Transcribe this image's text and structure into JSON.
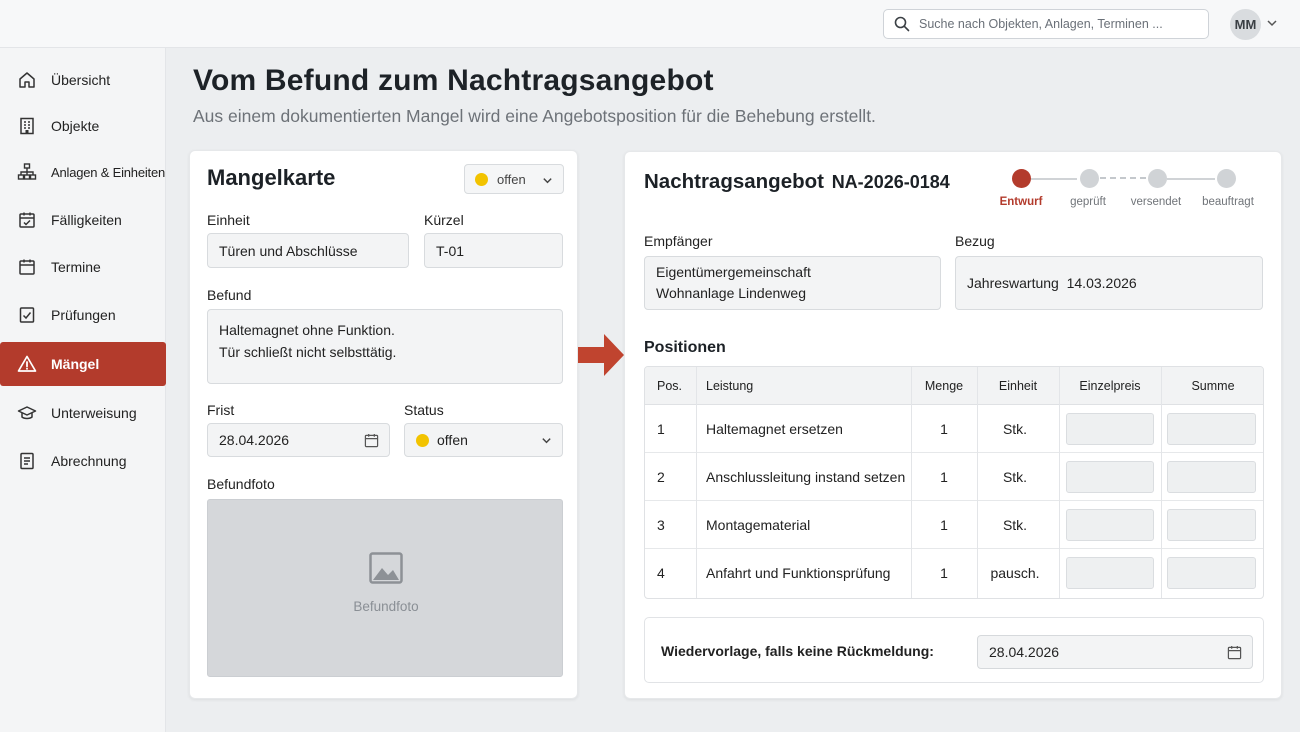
{
  "search": {
    "placeholder": "Suche nach Objekten, Anlagen, Terminen ..."
  },
  "user": {
    "initials": "MM"
  },
  "sidebar": {
    "items": [
      {
        "label": "Übersicht",
        "icon": "home-icon"
      },
      {
        "label": "Objekte",
        "icon": "building-icon"
      },
      {
        "label": "Anlagen & Einheiten",
        "icon": "hierarchy-icon"
      },
      {
        "label": "Fälligkeiten",
        "icon": "calendar-check-icon"
      },
      {
        "label": "Termine",
        "icon": "calendar-icon"
      },
      {
        "label": "Prüfungen",
        "icon": "checklist-icon"
      },
      {
        "label": "Mängel",
        "icon": "warning-icon",
        "active": true
      },
      {
        "label": "Unterweisung",
        "icon": "graduation-cap-icon"
      },
      {
        "label": "Abrechnung",
        "icon": "document-icon"
      }
    ]
  },
  "header": {
    "title": "Vom Befund zum Nachtragsangebot",
    "subtitle": "Aus einem dokumentierten Mangel wird eine Angebotsposition für die Behebung erstellt."
  },
  "mangelkarte": {
    "title": "Mangelkarte",
    "status_badge": "offen",
    "einheit_label": "Einheit",
    "einheit_value": "Türen und Abschlüsse",
    "kuerzel_label": "Kürzel",
    "kuerzel_value": "T-01",
    "befund_label": "Befund",
    "befund_line1": "Haltemagnet ohne Funktion.",
    "befund_line2": "Tür schließt nicht selbsttätig.",
    "frist_label": "Frist",
    "frist_value": "28.04.2026",
    "status_label": "Status",
    "status_value": "offen",
    "foto_label": "Befundfoto",
    "foto_placeholder": "Befundfoto"
  },
  "angebot": {
    "title": "Nachtragsangebot",
    "number": "NA-2026-0184",
    "steps": [
      "Entwurf",
      "geprüft",
      "versendet",
      "beauftragt"
    ],
    "empfaenger_label": "Empfänger",
    "empfaenger_line1": "Eigentümergemeinschaft",
    "empfaenger_line2": "Wohnanlage Lindenweg",
    "bezug_label": "Bezug",
    "bezug_value": "Jahreswartung  14.03.2026",
    "positionen_title": "Positionen",
    "columns": [
      "Pos.",
      "Leistung",
      "Menge",
      "Einheit",
      "Einzelpreis",
      "Summe"
    ],
    "rows": [
      {
        "pos": "1",
        "leistung": "Haltemagnet ersetzen",
        "menge": "1",
        "einheit": "Stk."
      },
      {
        "pos": "2",
        "leistung": "Anschlussleitung instand setzen",
        "menge": "1",
        "einheit": "Stk."
      },
      {
        "pos": "3",
        "leistung": "Montagematerial",
        "menge": "1",
        "einheit": "Stk."
      },
      {
        "pos": "4",
        "leistung": "Anfahrt und Funktionsprüfung",
        "menge": "1",
        "einheit": "pausch."
      }
    ],
    "wiedervorlage_label": "Wiedervorlage, falls keine Rückmeldung:",
    "wiedervorlage_value": "28.04.2026"
  },
  "colors": {
    "accent": "#b33b2c",
    "status_open": "#f2c300"
  }
}
